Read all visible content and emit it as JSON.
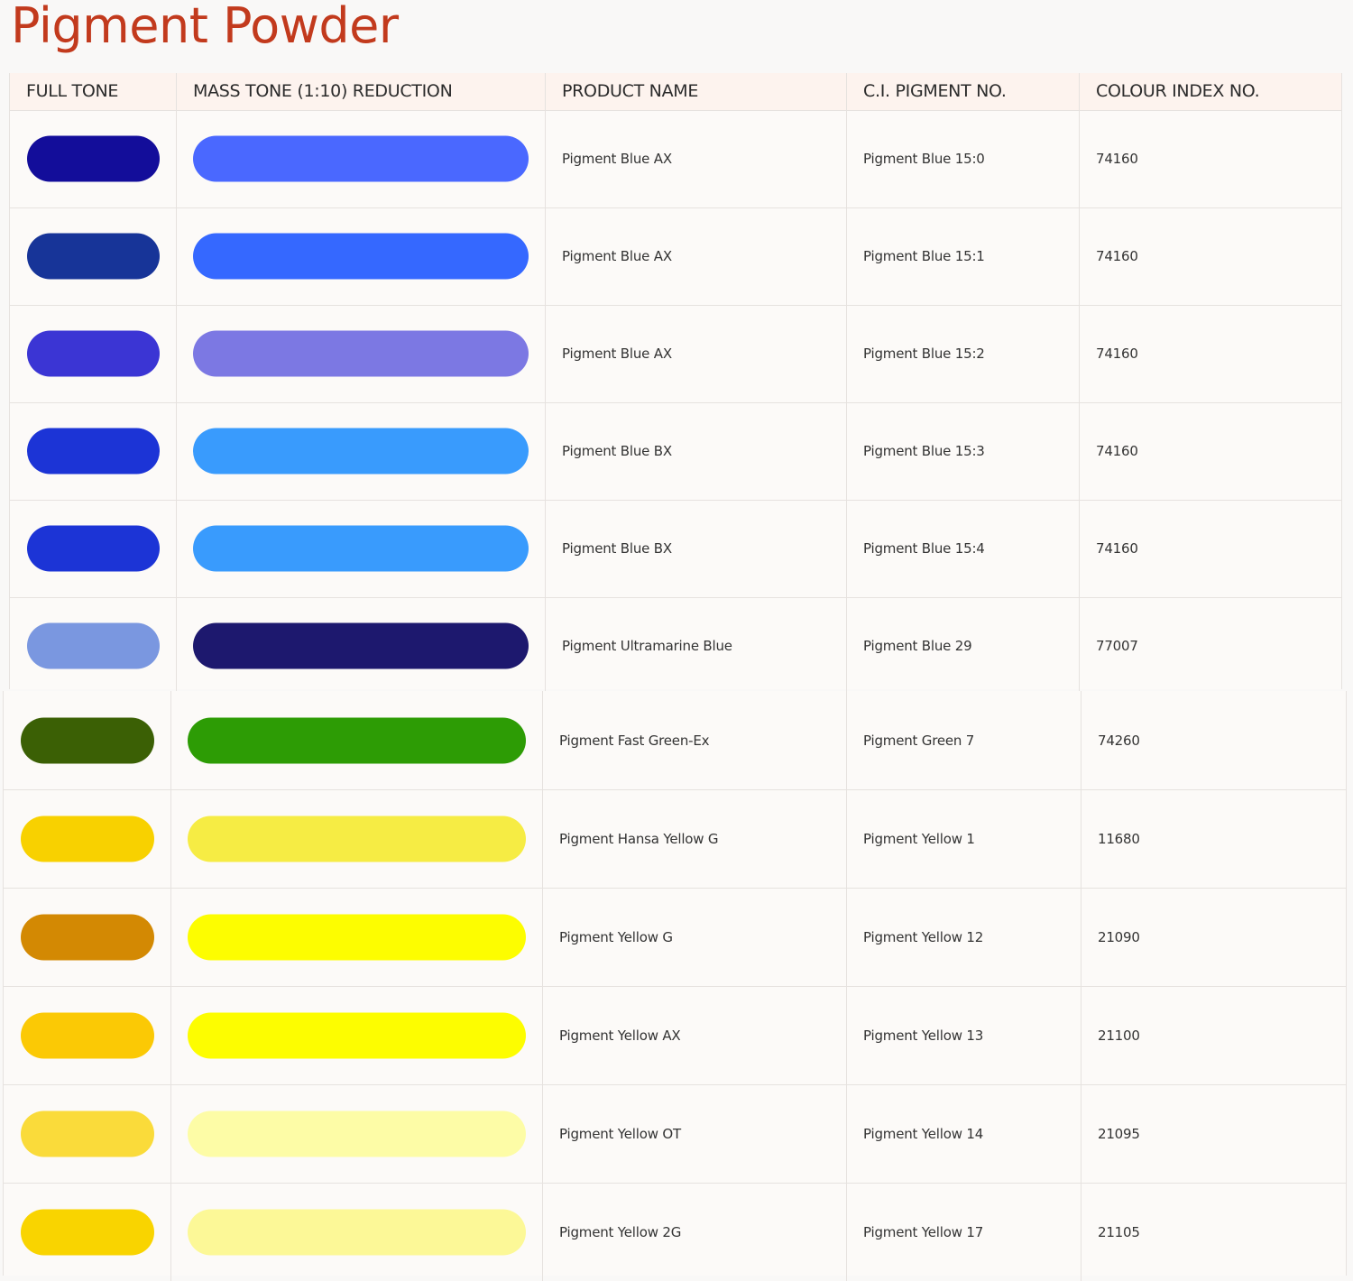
{
  "page": {
    "title": "Pigment Powder",
    "title_color": "#c23a1d"
  },
  "table": {
    "headers": {
      "full_tone": "FULL TONE",
      "mass_tone": "MASS TONE (1:10) REDUCTION",
      "product_name": "PRODUCT NAME",
      "ci_pigment_no": "C.I. PIGMENT NO.",
      "colour_index_no": "COLOUR INDEX NO."
    },
    "rows": [
      {
        "full_tone_color": "#130d9a",
        "mass_tone_color": "#4a68ff",
        "product_name": "Pigment Blue AX",
        "ci_pigment_no": "Pigment Blue 15:0",
        "colour_index_no": "74160"
      },
      {
        "full_tone_color": "#173498",
        "mass_tone_color": "#3568ff",
        "product_name": "Pigment Blue AX",
        "ci_pigment_no": "Pigment Blue 15:1",
        "colour_index_no": "74160"
      },
      {
        "full_tone_color": "#3b35d4",
        "mass_tone_color": "#7c78e3",
        "product_name": "Pigment Blue AX",
        "ci_pigment_no": "Pigment Blue 15:2",
        "colour_index_no": "74160"
      },
      {
        "full_tone_color": "#1c34d6",
        "mass_tone_color": "#399bfd",
        "product_name": "Pigment Blue BX",
        "ci_pigment_no": "Pigment Blue 15:3",
        "colour_index_no": "74160"
      },
      {
        "full_tone_color": "#1c34d6",
        "mass_tone_color": "#399bfd",
        "product_name": "Pigment Blue BX",
        "ci_pigment_no": "Pigment Blue 15:4",
        "colour_index_no": "74160"
      },
      {
        "full_tone_color": "#7a97e0",
        "mass_tone_color": "#1d186e",
        "product_name": "Pigment Ultramarine Blue",
        "ci_pigment_no": "Pigment Blue 29",
        "colour_index_no": "77007"
      },
      {
        "full_tone_color": "#3b6005",
        "mass_tone_color": "#2d9c05",
        "product_name": "Pigment Fast Green-Ex",
        "ci_pigment_no": "Pigment Green 7",
        "colour_index_no": "74260"
      },
      {
        "full_tone_color": "#f8d100",
        "mass_tone_color": "#f6ec44",
        "product_name": "Pigment Hansa Yellow G",
        "ci_pigment_no": "Pigment Yellow 1",
        "colour_index_no": "11680"
      },
      {
        "full_tone_color": "#d38903",
        "mass_tone_color": "#fdfd00",
        "product_name": "Pigment Yellow G",
        "ci_pigment_no": "Pigment Yellow 12",
        "colour_index_no": "21090"
      },
      {
        "full_tone_color": "#fbc905",
        "mass_tone_color": "#fdfd00",
        "product_name": "Pigment Yellow AX",
        "ci_pigment_no": "Pigment Yellow 13",
        "colour_index_no": "21100"
      },
      {
        "full_tone_color": "#fadb3a",
        "mass_tone_color": "#fdfca6",
        "product_name": "Pigment Yellow OT",
        "ci_pigment_no": "Pigment Yellow 14",
        "colour_index_no": "21095"
      },
      {
        "full_tone_color": "#f9d400",
        "mass_tone_color": "#fcf897",
        "product_name": "Pigment Yellow 2G",
        "ci_pigment_no": "Pigment Yellow 17",
        "colour_index_no": "21105"
      }
    ]
  }
}
